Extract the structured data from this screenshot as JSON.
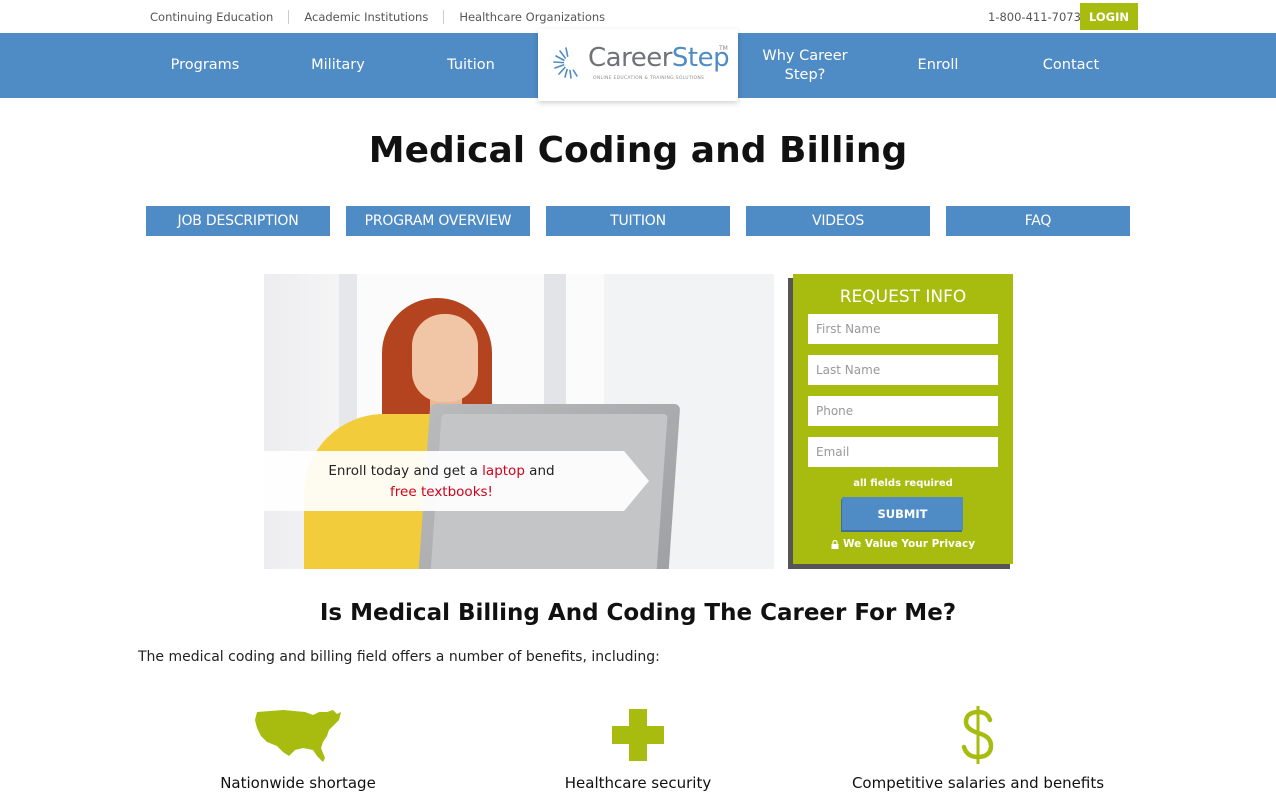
{
  "utility": {
    "links": [
      "Continuing Education",
      "Academic Institutions",
      "Healthcare Organizations"
    ],
    "phone": "1-800-411-7073",
    "login_label": "LOGIN"
  },
  "nav": {
    "left": [
      "Programs",
      "Military",
      "Tuition"
    ],
    "right": [
      "Why Career Step?",
      "Enroll",
      "Contact"
    ]
  },
  "logo": {
    "career": "Career",
    "step": "Step",
    "tm": "TM",
    "tagline": "ONLINE EDUCATION & TRAINING SOLUTIONS"
  },
  "page": {
    "title": "Medical Coding and Billing"
  },
  "tabs": [
    "JOB DESCRIPTION",
    "PROGRAM OVERVIEW",
    "TUITION",
    "VIDEOS",
    "FAQ"
  ],
  "promo": {
    "line1_prefix": "Enroll today and get a ",
    "line1_highlight": "laptop",
    "line1_suffix": " and",
    "line2_highlight": "free textbooks!"
  },
  "form": {
    "title": "REQUEST INFO",
    "first_name_placeholder": "First Name",
    "last_name_placeholder": "Last Name",
    "phone_placeholder": "Phone",
    "email_placeholder": "Email",
    "required_note": "all fields required",
    "submit_label": "SUBMIT",
    "privacy_label": "We Value Your Privacy"
  },
  "section": {
    "title": "Is Medical Billing And Coding The Career For Me?",
    "intro": "The medical coding and billing field offers a number of benefits, including:"
  },
  "benefits": [
    {
      "icon": "usa-map-icon",
      "label": "Nationwide shortage"
    },
    {
      "icon": "plus-cross-icon",
      "label": "Healthcare security"
    },
    {
      "icon": "dollar-sign-icon",
      "label": "Competitive salaries and benefits"
    }
  ],
  "colors": {
    "nav_blue": "#4f8bc4",
    "accent_green": "#a7bc0f",
    "promo_red": "#d0021b"
  }
}
